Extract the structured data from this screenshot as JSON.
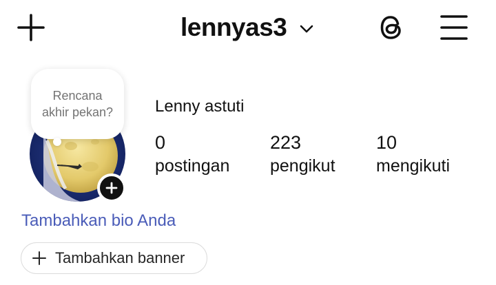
{
  "header": {
    "username": "lennyas3",
    "icons": {
      "add": "plus-icon",
      "switch_account": "chevron-down-icon",
      "threads": "threads-icon",
      "menu": "hamburger-menu-icon"
    }
  },
  "profile": {
    "note": "Rencana akhir pekan?",
    "full_name": "Lenny astuti",
    "avatar_description_icon": "moon-avatar",
    "stats": {
      "posts": {
        "value": "0",
        "label": "postingan"
      },
      "followers": {
        "value": "223",
        "label": "pengikut"
      },
      "following": {
        "value": "10",
        "label": "mengikuti"
      }
    },
    "add_bio": "Tambahkan bio Anda",
    "add_banner": "Tambahkan banner"
  },
  "colors": {
    "text": "#111111",
    "link": "#4a5cb8",
    "muted": "#737373",
    "border": "#dbdbdb"
  }
}
